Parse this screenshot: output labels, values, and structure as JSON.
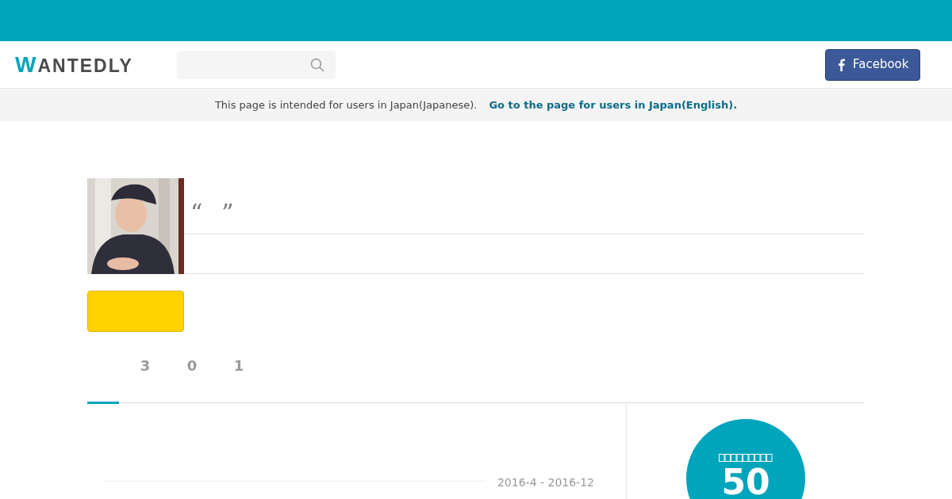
{
  "logo": "WANTEDLY",
  "facebook_button": {
    "label": "Facebook"
  },
  "notice": {
    "text": "This page is intended for users in Japan(Japanese).",
    "link": "Go to the page for users in Japan(English)."
  },
  "profile": {
    "open_quote": "“",
    "close_quote": "”"
  },
  "tabs": [
    {
      "selected": true
    },
    {
      "count": "3",
      "selected": false
    },
    {
      "count": "0",
      "selected": false
    },
    {
      "count": "1",
      "selected": false
    }
  ],
  "experience": {
    "period": "2016-4 - 2016-12"
  },
  "score": {
    "value": "50"
  }
}
